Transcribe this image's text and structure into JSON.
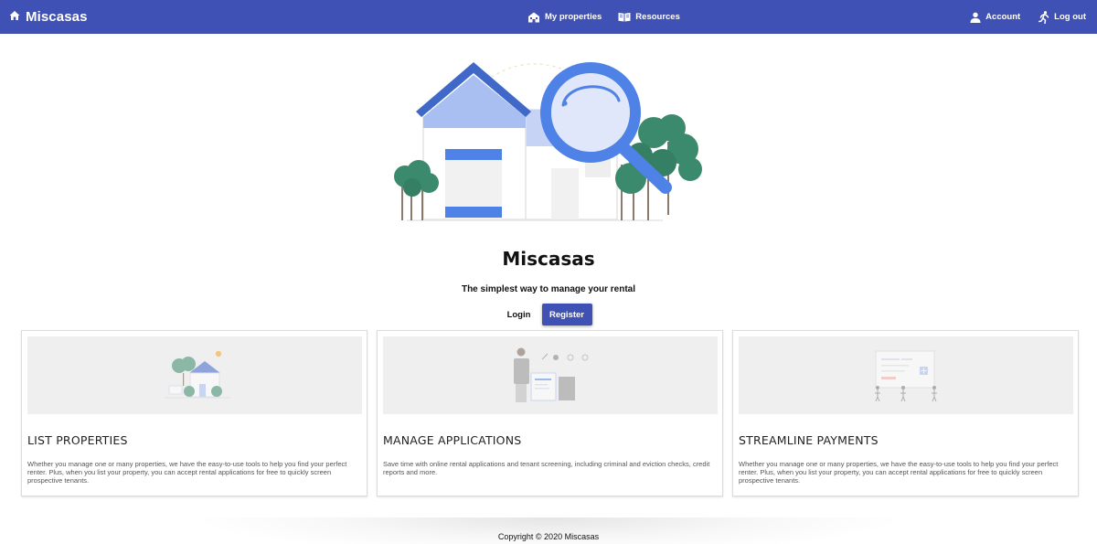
{
  "theme": {
    "nav_color": "#3f51b5",
    "accent_blue": "#4f82e6",
    "tree_green": "#3b8a6e"
  },
  "navbar": {
    "brand": {
      "icon": "home-icon",
      "label": "Miscasas"
    },
    "center_links": [
      {
        "icon": "properties-icon",
        "label": "My properties"
      },
      {
        "icon": "book-icon",
        "label": "Resources"
      }
    ],
    "right_links": [
      {
        "icon": "person-icon",
        "label": "Account"
      },
      {
        "icon": "running-person-icon",
        "label": "Log out"
      }
    ]
  },
  "hero": {
    "illustration": "house-with-magnifying-glass-illustration",
    "title": "Miscasas",
    "subtitle": "The simplest way to manage your rental",
    "login_label": "Login",
    "register_label": "Register"
  },
  "cards": [
    {
      "illustration": "house-illustration",
      "title": "LIST PROPERTIES",
      "text": "Whether you manage one or many properties, we have the easy-to-use tools to help you find your perfect renter. Plus, when you list your property, you can accept rental applications for free to quickly screen prospective tenants."
    },
    {
      "illustration": "applications-illustration",
      "title": "MANAGE APPLICATIONS",
      "text": "Save time with online rental applications and tenant screening, including criminal and eviction checks, credit reports and more."
    },
    {
      "illustration": "payments-illustration",
      "title": "STREAMLINE PAYMENTS",
      "text": "Whether you manage one or many properties, we have the easy-to-use tools to help you find your perfect renter. Plus, when you list your property, you can accept rental applications for free to quickly screen prospective tenants."
    }
  ],
  "footer": {
    "copyright": "Copyright © 2020 Miscasas"
  }
}
